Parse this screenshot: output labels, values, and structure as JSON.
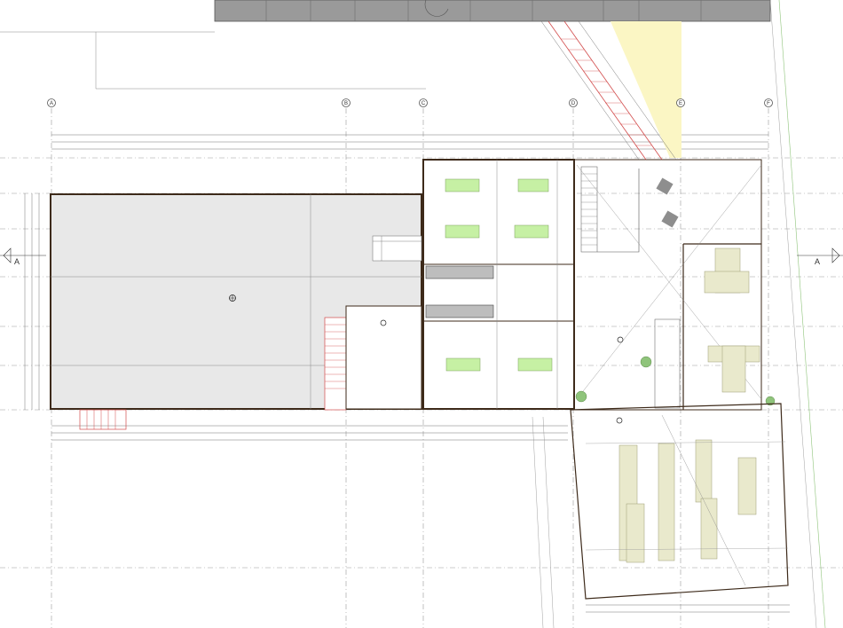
{
  "grid_axes": [
    {
      "label": "A"
    },
    {
      "label": "B"
    },
    {
      "label": "C"
    },
    {
      "label": "D"
    },
    {
      "label": "E"
    },
    {
      "label": "F"
    }
  ],
  "section_markers": {
    "left": "A",
    "right": "A"
  },
  "colors": {
    "existing_building": "#9a9a9a",
    "hall_fill": "#e8e8e8",
    "wall": "#3d2a1a",
    "table_green": "#c6f0a4",
    "furniture_beige": "#e9e9cc",
    "stair_red": "#d24a4a",
    "highlight_yellow": "#fbf6c4"
  }
}
